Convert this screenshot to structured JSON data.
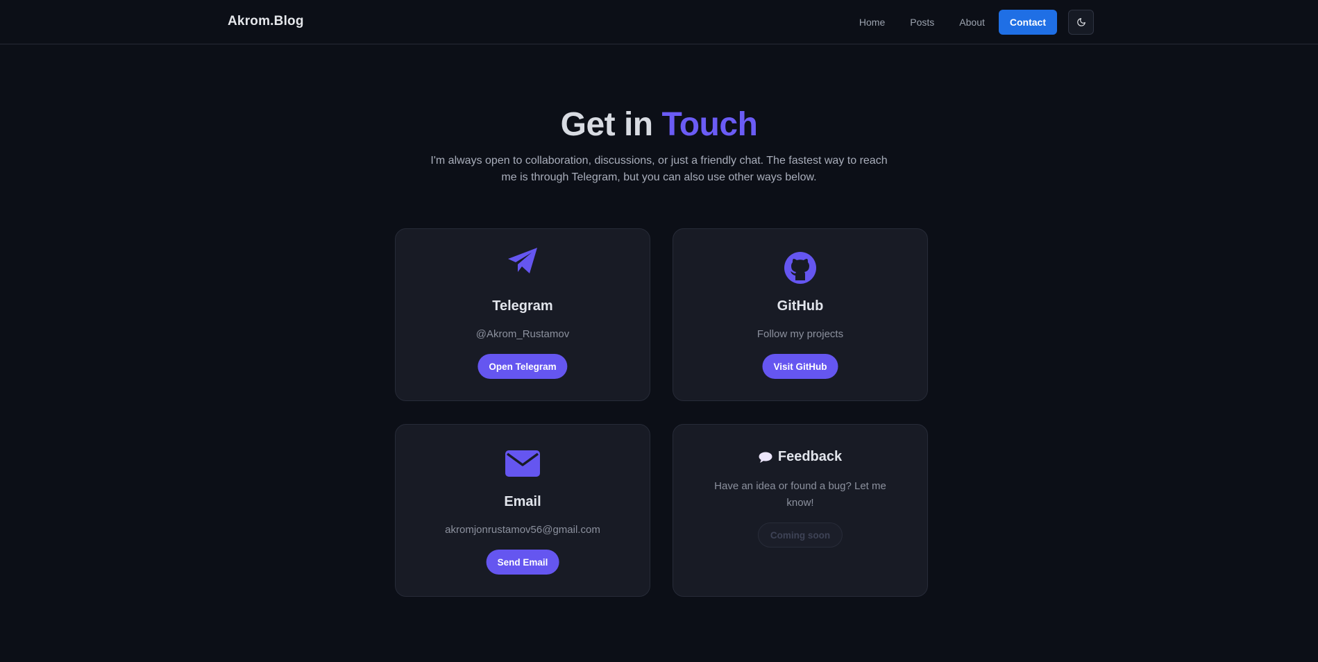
{
  "header": {
    "brand": "Akrom.Blog",
    "nav": {
      "home": "Home",
      "posts": "Posts",
      "about": "About",
      "contact": "Contact"
    },
    "theme_toggle_icon": "moon-icon"
  },
  "hero": {
    "title_part1": "Get in",
    "title_part2": "Touch",
    "subtitle": "I'm always open to collaboration, discussions, or just a friendly chat. The fastest way to reach me is through Telegram, but you can also use other ways below."
  },
  "cards": {
    "telegram": {
      "icon": "paper-plane-icon",
      "title": "Telegram",
      "subtitle": "@Akrom_Rustamov",
      "button": "Open Telegram"
    },
    "github": {
      "icon": "github-icon",
      "title": "GitHub",
      "subtitle": "Follow my projects",
      "button": "Visit GitHub"
    },
    "email": {
      "icon": "envelope-icon",
      "title": "Email",
      "subtitle": "akromjonrustamov56@gmail.com",
      "button": "Send Email"
    },
    "feedback": {
      "icon": "speech-bubble-icon",
      "title": "Feedback",
      "text": "Have an idea or found a bug? Let me know!",
      "button": "Coming soon"
    }
  },
  "colors": {
    "background": "#0c0f17",
    "card": "#181b25",
    "accent": "#6556f0",
    "contact_button": "#1f6fe5"
  }
}
